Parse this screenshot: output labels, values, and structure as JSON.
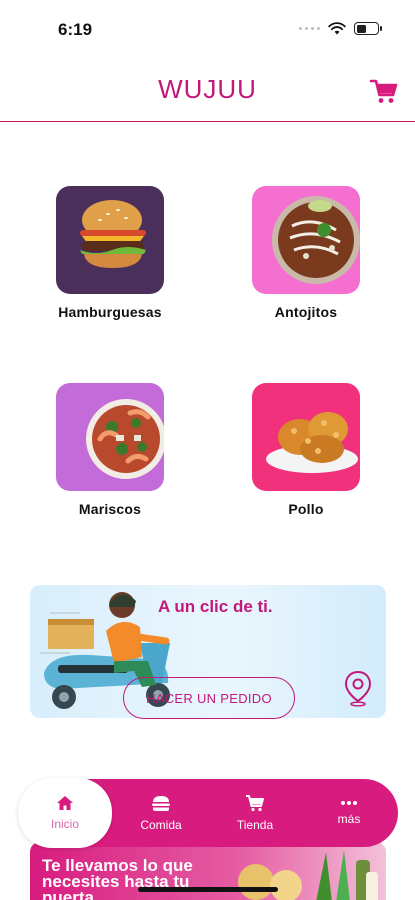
{
  "status_bar": {
    "time": "6:19"
  },
  "header": {
    "title": "WUJUU"
  },
  "categories": [
    {
      "label": "Hamburguesas",
      "tile_color": "#4a2f5a"
    },
    {
      "label": "Antojitos",
      "tile_color": "#f56fd0"
    },
    {
      "label": "Mariscos",
      "tile_color": "#c36bd9"
    },
    {
      "label": "Pollo",
      "tile_color": "#f2317d"
    }
  ],
  "promo": {
    "title": "A un clic de ti.",
    "button_label": "HACER UN PEDIDO"
  },
  "bottom_nav": {
    "items": [
      {
        "label": "Inicio",
        "icon": "home-icon",
        "active": true
      },
      {
        "label": "Comida",
        "icon": "burger-icon",
        "active": false
      },
      {
        "label": "Tienda",
        "icon": "cart-icon",
        "active": false
      },
      {
        "label": "más",
        "icon": "more-icon",
        "active": false
      }
    ]
  },
  "promo2": {
    "text": "Te llevamos lo que necesites hasta tu puerta"
  },
  "colors": {
    "brand": "#c2187c",
    "nav_bg": "#d81b7f"
  }
}
